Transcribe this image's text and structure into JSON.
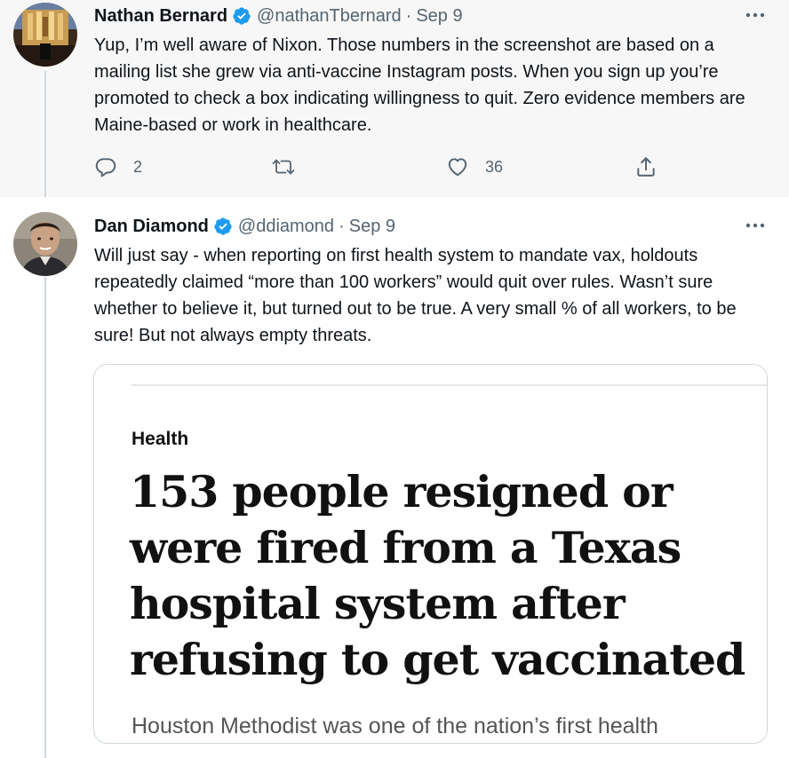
{
  "tweets": [
    {
      "author": {
        "name": "Nathan Bernard",
        "handle": "@nathanTbernard",
        "verified": true,
        "avatar_icon": "cathedral-interior-photo"
      },
      "separator": "·",
      "timestamp": "Sep 9",
      "text": "Yup, I’m well aware of Nixon. Those numbers in the screenshot are based on a mailing list she grew via anti-vaccine Instagram posts. When you sign up you’re promoted to check a box indicating willingness to quit. Zero evidence members are Maine-based or work in healthcare.",
      "actions": {
        "reply_count": "2",
        "retweet_count": "",
        "like_count": "36"
      }
    },
    {
      "author": {
        "name": "Dan Diamond",
        "handle": "@ddiamond",
        "verified": true,
        "avatar_icon": "profile-photo"
      },
      "separator": "·",
      "timestamp": "Sep 9",
      "text": "Will just say - when reporting on first health system to mandate vax, holdouts repeatedly claimed “more than 100 workers” would quit over rules. Wasn’t sure whether to believe it, but turned out to be true. A very small % of all workers, to be sure! But not always empty threats.",
      "card": {
        "section": "Health",
        "headline": "153 people resigned or were fired from a Texas hospital system after refusing to get vaccinated",
        "subtext": "Houston Methodist was one of the nation’s first health"
      }
    }
  ],
  "colors": {
    "verified_badge": "#1d9bf0",
    "secondary_text": "#536471",
    "thread_line": "#cfd9de",
    "tweet_1_background": "#f7f7f7"
  }
}
